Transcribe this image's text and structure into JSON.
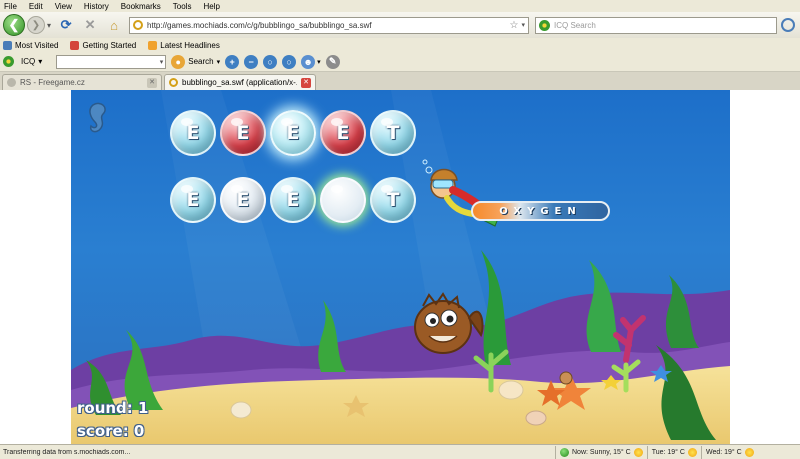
{
  "menu": [
    "File",
    "Edit",
    "View",
    "History",
    "Bookmarks",
    "Tools",
    "Help"
  ],
  "nav": {
    "url": "http://games.mochiads.com/c/g/bubblingo_sa/bubblingo_sa.swf",
    "search_placeholder": "ICQ Search"
  },
  "bookmarks": [
    {
      "label": "Most Visited",
      "color": "#4a7db8"
    },
    {
      "label": "Getting Started",
      "color": "#d4453b"
    },
    {
      "label": "Latest Headlines",
      "color": "#f0a22e"
    }
  ],
  "icqbar": {
    "brand": "ICQ",
    "search_label": "Search"
  },
  "tabs": [
    {
      "title": "RS - Freegame.cz",
      "active": false
    },
    {
      "title": "bubblingo_sa.swf (application/x-...",
      "active": true
    }
  ],
  "game": {
    "row1": [
      {
        "letter": "E",
        "style": "cyan"
      },
      {
        "letter": "E",
        "style": "red"
      },
      {
        "letter": "E",
        "style": "glow"
      },
      {
        "letter": "E",
        "style": "red"
      },
      {
        "letter": "T",
        "style": "cyan"
      }
    ],
    "row2": [
      {
        "letter": "E",
        "style": "cyan"
      },
      {
        "letter": "E",
        "style": "white"
      },
      {
        "letter": "E",
        "style": "cyan"
      },
      {
        "letter": "",
        "style": "empty"
      },
      {
        "letter": "T",
        "style": "cyan"
      }
    ],
    "oxygen_label": "OXYGEN",
    "oxygen_level": 0.3,
    "round_text": "round: 1",
    "score_text": "score: 0"
  },
  "status": {
    "text": "Transferring data from s.mochiads.com...",
    "weather": [
      {
        "label": "Now: Sunny, 15° C",
        "icon": "green"
      },
      {
        "label": "Tue: 19° C",
        "icon": "sun"
      },
      {
        "label": "Wed: 19° C",
        "icon": "sun"
      }
    ]
  },
  "colors": {
    "water": "#2a7fd1",
    "sand": "#f3dc8f",
    "accent_red": "#d8404a"
  }
}
